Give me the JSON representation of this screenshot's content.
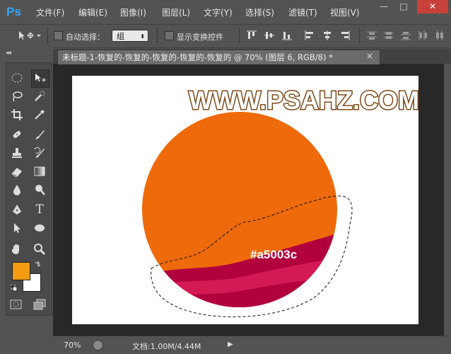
{
  "app": {
    "logo": "Ps"
  },
  "menu": [
    "文件(F)",
    "编辑(E)",
    "图像(I)",
    "图层(L)",
    "文字(Y)",
    "选择(S)",
    "滤镜(T)",
    "视图(V)"
  ],
  "window_controls": {
    "minimize": "—",
    "maximize": "□",
    "close": "✕"
  },
  "options": {
    "auto_select_label": "自动选择：",
    "auto_select_value": "组",
    "show_transform_label": "显示变换控件"
  },
  "document": {
    "tab_title": "未标题-1-恢复的-恢复的-恢复的-恢复的-恢复的 @ 70% (图层 6, RGB/8) *",
    "tab_close": "×"
  },
  "canvas": {
    "watermark": "WWW.PSAHZ.COM",
    "color_label": "#a5003c"
  },
  "colors": {
    "orange": "#ee6a0a",
    "crimson": "#b2003f",
    "pink": "#d41a55",
    "foreground_swatch": "#f39c12",
    "background_swatch": "#ffffff",
    "watermark_fill": "#ffffff",
    "watermark_stroke": "#7a4a1a"
  },
  "status": {
    "zoom": "70%",
    "doc_info": "文档:1.00M/4.44M"
  },
  "toolbar": {
    "collapse": "◂◂",
    "type_tool": "T"
  }
}
